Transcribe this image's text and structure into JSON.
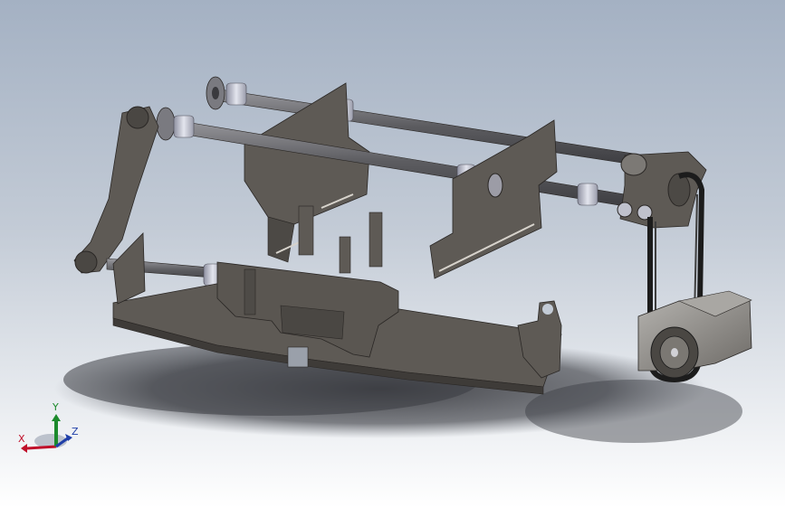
{
  "viewport": {
    "background_top": "#a4b1c3",
    "background_bottom": "#ffffff"
  },
  "model": {
    "part_color": "#5e5a55",
    "part_edge_color": "#2a2725",
    "shaft_color": "#6e6e72",
    "bushing_color": "#c9cbd4",
    "belt_color": "#1c1c1c",
    "motor_color": "#8d8a86"
  },
  "triad": {
    "x_label": "X",
    "y_label": "Y",
    "z_label": "Z",
    "x_color": "#c0102a",
    "y_color": "#1c8a2c",
    "z_color": "#1f3fa8"
  }
}
